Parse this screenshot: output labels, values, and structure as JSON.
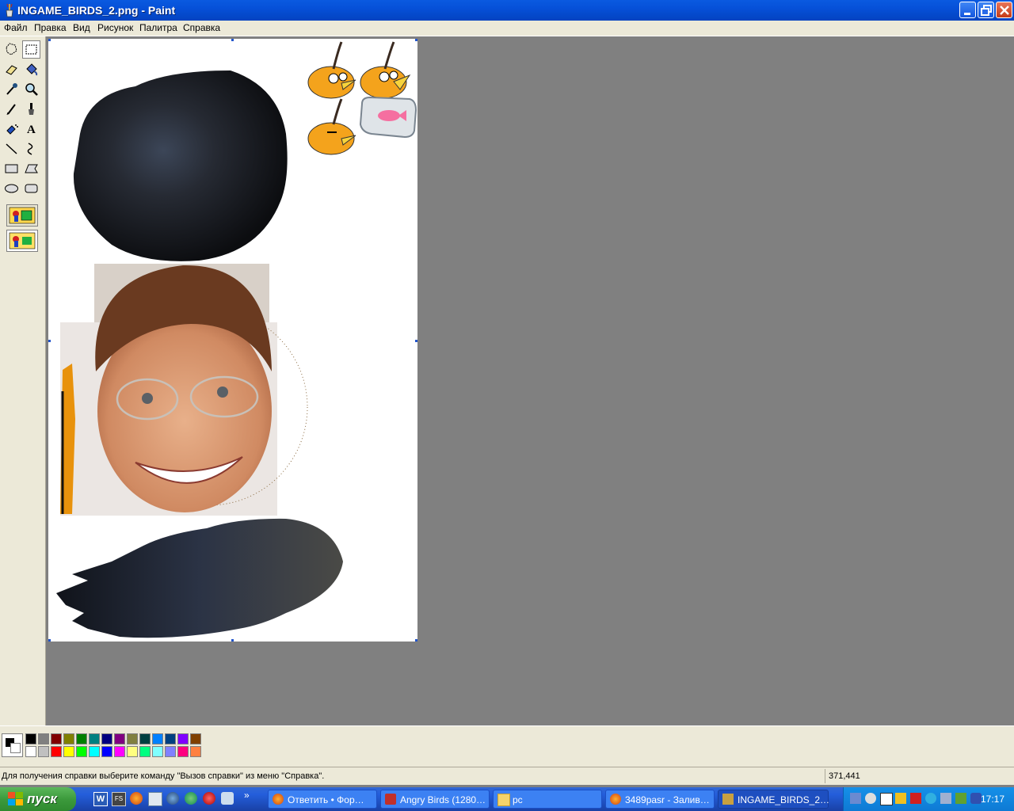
{
  "window": {
    "title": "INGAME_BIRDS_2.png - Paint",
    "controls": [
      "minimize",
      "restore",
      "close"
    ]
  },
  "menu": [
    "Файл",
    "Правка",
    "Вид",
    "Рисунок",
    "Палитра",
    "Справка"
  ],
  "toolbox": {
    "tools": [
      "free-select",
      "rect-select",
      "eraser",
      "fill",
      "color-picker",
      "magnifier",
      "pencil",
      "brush",
      "airbrush",
      "text",
      "line",
      "curve",
      "rectangle",
      "polygon",
      "ellipse",
      "rounded-rect"
    ],
    "selected_tool": "rect-select"
  },
  "palette": {
    "foreground": "#000000",
    "background": "#ffffff",
    "colors_row1": [
      "#000000",
      "#808080",
      "#800000",
      "#808000",
      "#008000",
      "#008080",
      "#000080",
      "#800080",
      "#808040",
      "#004040",
      "#0080ff",
      "#004080",
      "#8000ff",
      "#804000"
    ],
    "colors_row2": [
      "#ffffff",
      "#c0c0c0",
      "#ff0000",
      "#ffff00",
      "#00ff00",
      "#00ffff",
      "#0000ff",
      "#ff00ff",
      "#ffff80",
      "#00ff80",
      "#80ffff",
      "#8080ff",
      "#ff0080",
      "#ff8040"
    ]
  },
  "status": {
    "help_text": "Для получения справки выберите команду \"Вызов справки\" из меню \"Справка\".",
    "coords": "371,441"
  },
  "taskbar": {
    "start_label": "пуск",
    "tasks": [
      {
        "label": "Ответить • Фор…",
        "icon": "firefox-icon"
      },
      {
        "label": "Angry Birds (1280…",
        "icon": "image-icon"
      },
      {
        "label": "pc",
        "icon": "folder-icon"
      },
      {
        "label": "3489pasr - Залив…",
        "icon": "firefox-icon"
      },
      {
        "label": "INGAME_BIRDS_2…",
        "icon": "paint-icon",
        "active": true
      }
    ],
    "clock": "17:17"
  }
}
